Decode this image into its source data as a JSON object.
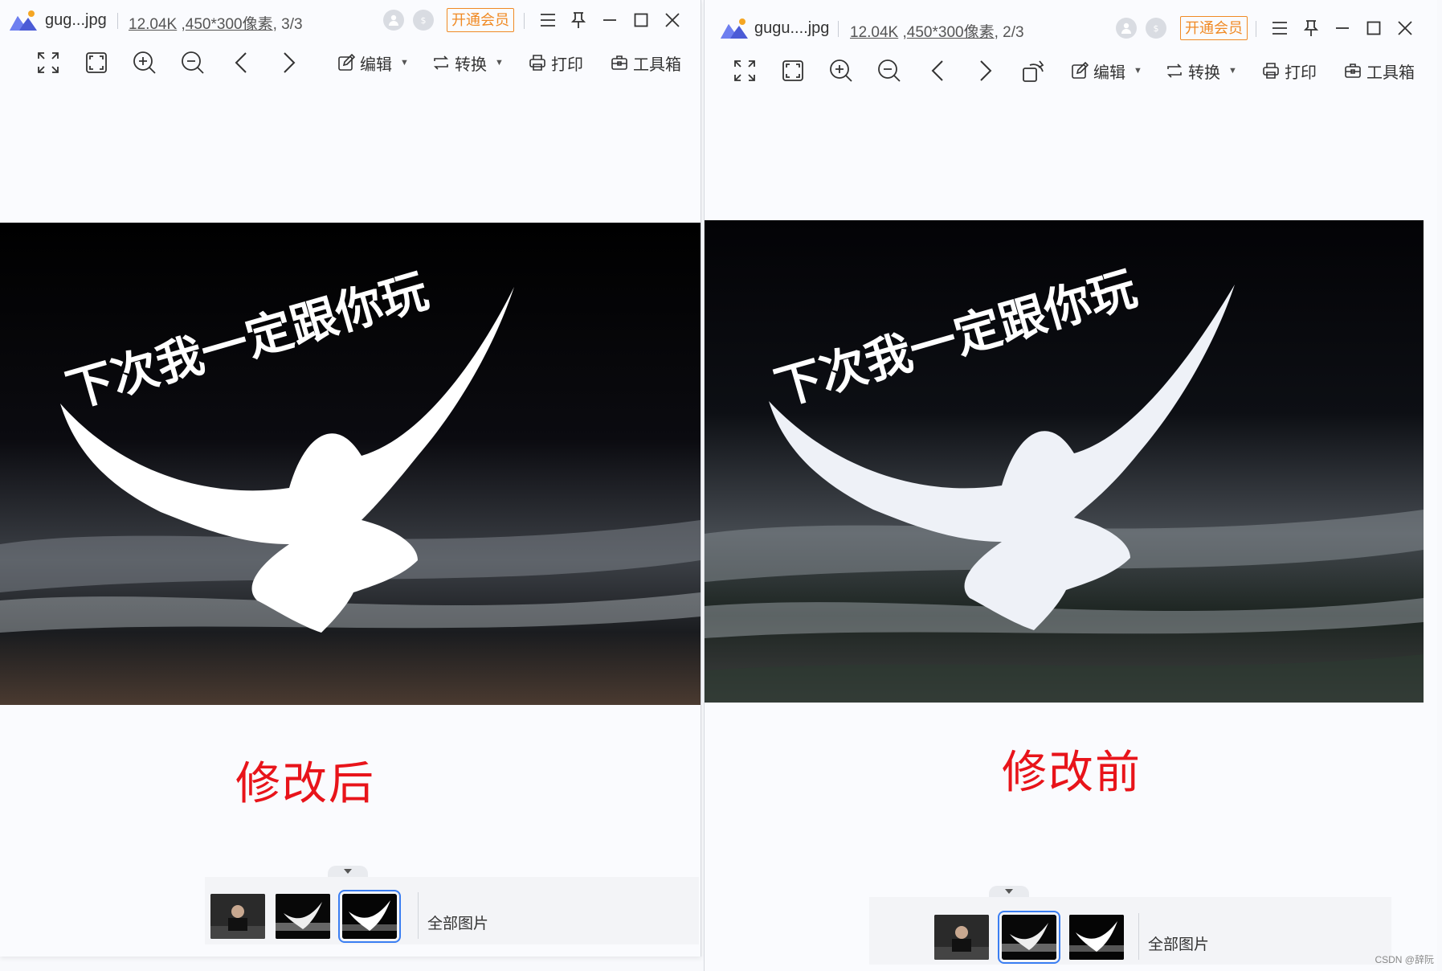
{
  "colors": {
    "accent": "#3a7ef2",
    "vip": "#f08a24",
    "caption": "#e8141a",
    "image_bg": "#050508"
  },
  "left_window": {
    "filename": "gug...jpg",
    "size": "12.04K",
    "dims": "450*300像素",
    "position": ", 3/3",
    "vip_label": "开通会员",
    "toolbar": {
      "edit": "编辑",
      "convert": "转换",
      "print": "打印",
      "tools": "工具箱"
    },
    "image_text": "下次我一定跟你玩",
    "caption": "修改后",
    "all_images": "全部图片",
    "selected_thumb": 3
  },
  "right_window": {
    "filename": "gugu....jpg",
    "size": "12.04K",
    "dims": "450*300像素",
    "position": ", 2/3",
    "vip_label": "开通会员",
    "toolbar": {
      "edit": "编辑",
      "convert": "转换",
      "print": "打印",
      "tools": "工具箱"
    },
    "image_text": "下次我一定跟你玩",
    "caption": "修改前",
    "all_images": "全部图片",
    "selected_thumb": 2
  },
  "watermark": "CSDN @辞阮",
  "icons": [
    "app-logo-icon",
    "avatar-icon",
    "coin-icon",
    "menu-icon",
    "pin-icon",
    "minimize-icon",
    "maximize-icon",
    "close-icon",
    "fullscreen-icon",
    "fit-icon",
    "zoom-in-icon",
    "zoom-out-icon",
    "prev-icon",
    "next-icon",
    "rotate-icon",
    "edit-icon",
    "convert-icon",
    "print-icon",
    "toolbox-icon",
    "chevron-down-icon"
  ]
}
